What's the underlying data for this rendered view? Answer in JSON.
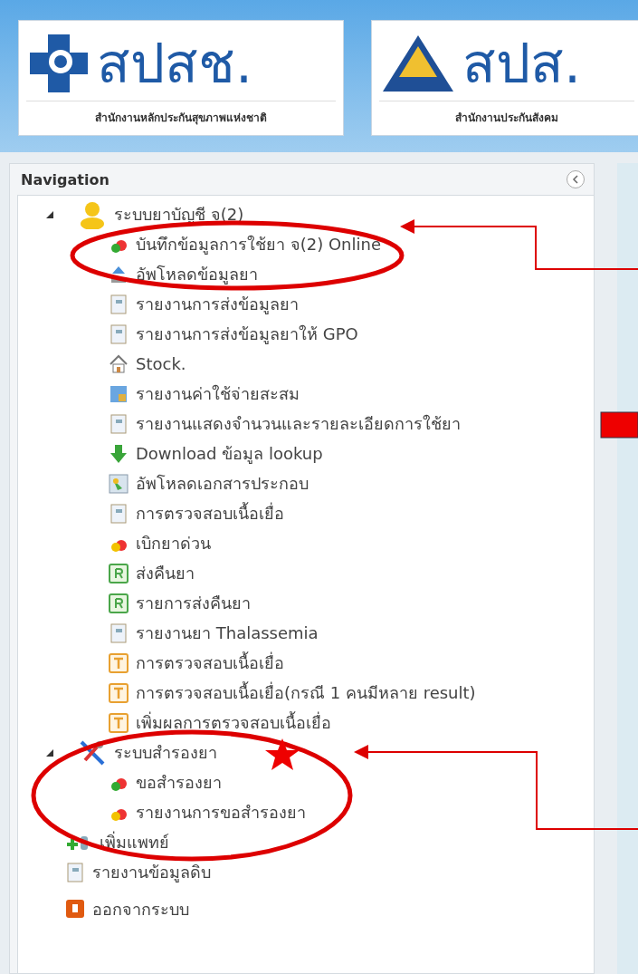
{
  "header": {
    "logos": [
      {
        "kind": "cross",
        "name": "สปสช.",
        "subtitle": "สำนักงานหลักประกันสุขภาพแห่งชาติ"
      },
      {
        "kind": "triangle",
        "name": "สปส.",
        "subtitle": "สำนักงานประกันสังคม"
      }
    ]
  },
  "navigation": {
    "title": "Navigation",
    "items": [
      {
        "label": "ระบบยาบัญชี จ(2)",
        "kind": "user",
        "expanded": true,
        "children": [
          {
            "label": "บันทึกข้อมูลการใช้ยา จ(2) Online",
            "kind": "pill"
          },
          {
            "label": "อัพโหลดข้อมูลยา",
            "kind": "upload"
          },
          {
            "label": "รายงานการส่งข้อมูลยา",
            "kind": "doc"
          },
          {
            "label": "รายงานการส่งข้อมูลยาให้ GPO",
            "kind": "doc"
          },
          {
            "label": "Stock.",
            "kind": "home"
          },
          {
            "label": "รายงานค่าใช้จ่ายสะสม",
            "kind": "chart"
          },
          {
            "label": "รายงานแสดงจำนวนและรายละเอียดการใช้ยา",
            "kind": "doc"
          },
          {
            "label": "Download ข้อมูล lookup",
            "kind": "download"
          },
          {
            "label": "อัพโหลดเอกสารประกอบ",
            "kind": "image"
          },
          {
            "label": "การตรวจสอบเนื้อเยื่อ",
            "kind": "doc"
          },
          {
            "label": "เบิกยาด่วน",
            "kind": "warn"
          },
          {
            "label": "ส่งคืนยา",
            "kind": "r"
          },
          {
            "label": "รายการส่งคืนยา",
            "kind": "r"
          },
          {
            "label": "รายงานยา Thalassemia",
            "kind": "doc"
          },
          {
            "label": "การตรวจสอบเนื้อเยื่อ",
            "kind": "t"
          },
          {
            "label": "การตรวจสอบเนื้อเยื่อ(กรณี 1 คนมีหลาย result)",
            "kind": "t"
          },
          {
            "label": "เพิ่มผลการตรวจสอบเนื้อเยื่อ",
            "kind": "t"
          }
        ]
      },
      {
        "label": "ระบบสำรองยา",
        "kind": "tools",
        "expanded": true,
        "children": [
          {
            "label": "ขอสำรองยา",
            "kind": "pill"
          },
          {
            "label": "รายงานการขอสำรองยา",
            "kind": "warn"
          }
        ]
      },
      {
        "label": "เพิ่มแพทย์",
        "kind": "adduser"
      },
      {
        "label": "รายงานข้อมูลดิบ",
        "kind": "doc"
      },
      {
        "label": "ออกจากระบบ",
        "kind": "exit"
      }
    ]
  }
}
